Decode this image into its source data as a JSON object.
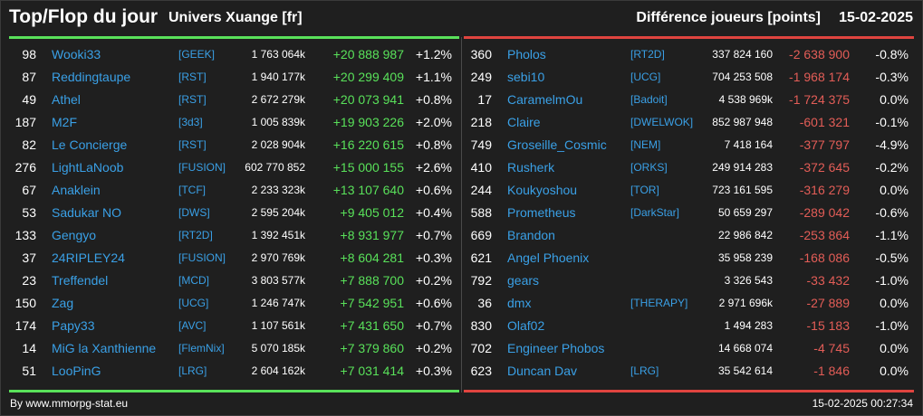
{
  "header": {
    "title": "Top/Flop du jour",
    "universe": "Univers Xuange [fr]",
    "metric": "Différence joueurs [points]",
    "date": "15-02-2025"
  },
  "colors": {
    "background": "#1f1f1f",
    "player_link": "#3aa0e6",
    "gain": "#59e15a",
    "loss": "#e35d57",
    "top_bar": "#59e15a",
    "flop_bar": "#e0443f"
  },
  "top": [
    {
      "rank": "98",
      "name": "Wooki33",
      "guild": "[GEEK]",
      "total": "1 763 064k",
      "diff": "+20 888 987",
      "pct": "+1.2%"
    },
    {
      "rank": "87",
      "name": "Reddingtaupe",
      "guild": "[RST]",
      "total": "1 940 177k",
      "diff": "+20 299 409",
      "pct": "+1.1%"
    },
    {
      "rank": "49",
      "name": "Athel",
      "guild": "[RST]",
      "total": "2 672 279k",
      "diff": "+20 073 941",
      "pct": "+0.8%"
    },
    {
      "rank": "187",
      "name": "M2F",
      "guild": "[3d3]",
      "total": "1 005 839k",
      "diff": "+19 903 226",
      "pct": "+2.0%"
    },
    {
      "rank": "82",
      "name": "Le Concierge",
      "guild": "[RST]",
      "total": "2 028 904k",
      "diff": "+16 220 615",
      "pct": "+0.8%"
    },
    {
      "rank": "276",
      "name": "LightLaNoob",
      "guild": "[FUSION]",
      "total": "602 770 852",
      "diff": "+15 000 155",
      "pct": "+2.6%"
    },
    {
      "rank": "67",
      "name": "Anaklein",
      "guild": "[TCF]",
      "total": "2 233 323k",
      "diff": "+13 107 640",
      "pct": "+0.6%"
    },
    {
      "rank": "53",
      "name": "Sadukar NO",
      "guild": "[DWS]",
      "total": "2 595 204k",
      "diff": "+9 405 012",
      "pct": "+0.4%"
    },
    {
      "rank": "133",
      "name": "Gengyo",
      "guild": "[RT2D]",
      "total": "1 392 451k",
      "diff": "+8 931 977",
      "pct": "+0.7%"
    },
    {
      "rank": "37",
      "name": "24RIPLEY24",
      "guild": "[FUSION]",
      "total": "2 970 769k",
      "diff": "+8 604 281",
      "pct": "+0.3%"
    },
    {
      "rank": "23",
      "name": "Treffendel",
      "guild": "[MCD]",
      "total": "3 803 577k",
      "diff": "+7 888 700",
      "pct": "+0.2%"
    },
    {
      "rank": "150",
      "name": "Zag",
      "guild": "[UCG]",
      "total": "1 246 747k",
      "diff": "+7 542 951",
      "pct": "+0.6%"
    },
    {
      "rank": "174",
      "name": "Papy33",
      "guild": "[AVC]",
      "total": "1 107 561k",
      "diff": "+7 431 650",
      "pct": "+0.7%"
    },
    {
      "rank": "14",
      "name": "MiG la Xanthienne",
      "guild": "[FlemNix]",
      "total": "5 070 185k",
      "diff": "+7 379 860",
      "pct": "+0.2%"
    },
    {
      "rank": "51",
      "name": "LooPinG",
      "guild": "[LRG]",
      "total": "2 604 162k",
      "diff": "+7 031 414",
      "pct": "+0.3%"
    }
  ],
  "flop": [
    {
      "rank": "360",
      "name": "Pholos",
      "guild": "[RT2D]",
      "total": "337 824 160",
      "diff": "-2 638 900",
      "pct": "-0.8%"
    },
    {
      "rank": "249",
      "name": "sebi10",
      "guild": "[UCG]",
      "total": "704 253 508",
      "diff": "-1 968 174",
      "pct": "-0.3%"
    },
    {
      "rank": "17",
      "name": "CaramelmOu",
      "guild": "[Badoit]",
      "total": "4 538 969k",
      "diff": "-1 724 375",
      "pct": "0.0%"
    },
    {
      "rank": "218",
      "name": "Claire",
      "guild": "[DWELWOK]",
      "total": "852 987 948",
      "diff": "-601 321",
      "pct": "-0.1%"
    },
    {
      "rank": "749",
      "name": "Groseille_Cosmic",
      "guild": "[NEM]",
      "total": "7 418 164",
      "diff": "-377 797",
      "pct": "-4.9%"
    },
    {
      "rank": "410",
      "name": "Rusherk",
      "guild": "[ORKS]",
      "total": "249 914 283",
      "diff": "-372 645",
      "pct": "-0.2%"
    },
    {
      "rank": "244",
      "name": "Koukyoshou",
      "guild": "[TOR]",
      "total": "723 161 595",
      "diff": "-316 279",
      "pct": "0.0%"
    },
    {
      "rank": "588",
      "name": "Prometheus",
      "guild": "[DarkStar]",
      "total": "50 659 297",
      "diff": "-289 042",
      "pct": "-0.6%"
    },
    {
      "rank": "669",
      "name": "Brandon",
      "guild": "",
      "total": "22 986 842",
      "diff": "-253 864",
      "pct": "-1.1%"
    },
    {
      "rank": "621",
      "name": "Angel Phoenix",
      "guild": "",
      "total": "35 958 239",
      "diff": "-168 086",
      "pct": "-0.5%"
    },
    {
      "rank": "792",
      "name": "gears",
      "guild": "",
      "total": "3 326 543",
      "diff": "-33 432",
      "pct": "-1.0%"
    },
    {
      "rank": "36",
      "name": "dmx",
      "guild": "[THERAPY]",
      "total": "2 971 696k",
      "diff": "-27 889",
      "pct": "0.0%"
    },
    {
      "rank": "830",
      "name": "Olaf02",
      "guild": "",
      "total": "1 494 283",
      "diff": "-15 183",
      "pct": "-1.0%"
    },
    {
      "rank": "702",
      "name": "Engineer Phobos",
      "guild": "",
      "total": "14 668 074",
      "diff": "-4 745",
      "pct": "0.0%"
    },
    {
      "rank": "623",
      "name": "Duncan Dav",
      "guild": "[LRG]",
      "total": "35 542 614",
      "diff": "-1 846",
      "pct": "0.0%"
    }
  ],
  "footer": {
    "credit": "By www.mmorpg-stat.eu",
    "timestamp": "15-02-2025 00:27:34"
  }
}
